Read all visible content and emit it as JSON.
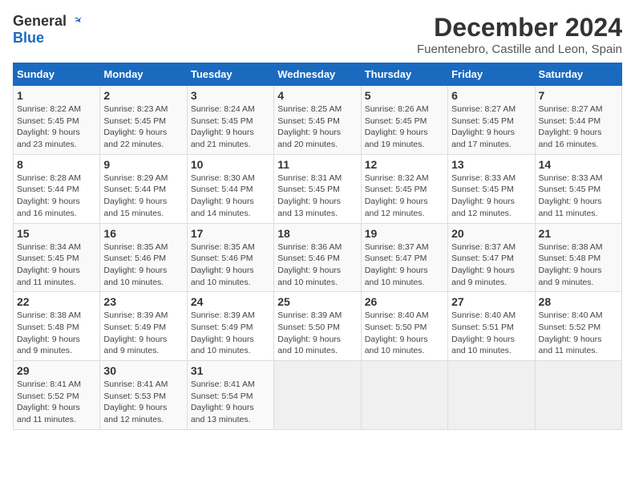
{
  "logo": {
    "general": "General",
    "blue": "Blue"
  },
  "title": "December 2024",
  "subtitle": "Fuentenebro, Castille and Leon, Spain",
  "days_of_week": [
    "Sunday",
    "Monday",
    "Tuesday",
    "Wednesday",
    "Thursday",
    "Friday",
    "Saturday"
  ],
  "weeks": [
    [
      {
        "day": "1",
        "info": "Sunrise: 8:22 AM\nSunset: 5:45 PM\nDaylight: 9 hours\nand 23 minutes."
      },
      {
        "day": "2",
        "info": "Sunrise: 8:23 AM\nSunset: 5:45 PM\nDaylight: 9 hours\nand 22 minutes."
      },
      {
        "day": "3",
        "info": "Sunrise: 8:24 AM\nSunset: 5:45 PM\nDaylight: 9 hours\nand 21 minutes."
      },
      {
        "day": "4",
        "info": "Sunrise: 8:25 AM\nSunset: 5:45 PM\nDaylight: 9 hours\nand 20 minutes."
      },
      {
        "day": "5",
        "info": "Sunrise: 8:26 AM\nSunset: 5:45 PM\nDaylight: 9 hours\nand 19 minutes."
      },
      {
        "day": "6",
        "info": "Sunrise: 8:27 AM\nSunset: 5:45 PM\nDaylight: 9 hours\nand 17 minutes."
      },
      {
        "day": "7",
        "info": "Sunrise: 8:27 AM\nSunset: 5:44 PM\nDaylight: 9 hours\nand 16 minutes."
      }
    ],
    [
      {
        "day": "8",
        "info": "Sunrise: 8:28 AM\nSunset: 5:44 PM\nDaylight: 9 hours\nand 16 minutes."
      },
      {
        "day": "9",
        "info": "Sunrise: 8:29 AM\nSunset: 5:44 PM\nDaylight: 9 hours\nand 15 minutes."
      },
      {
        "day": "10",
        "info": "Sunrise: 8:30 AM\nSunset: 5:44 PM\nDaylight: 9 hours\nand 14 minutes."
      },
      {
        "day": "11",
        "info": "Sunrise: 8:31 AM\nSunset: 5:45 PM\nDaylight: 9 hours\nand 13 minutes."
      },
      {
        "day": "12",
        "info": "Sunrise: 8:32 AM\nSunset: 5:45 PM\nDaylight: 9 hours\nand 12 minutes."
      },
      {
        "day": "13",
        "info": "Sunrise: 8:33 AM\nSunset: 5:45 PM\nDaylight: 9 hours\nand 12 minutes."
      },
      {
        "day": "14",
        "info": "Sunrise: 8:33 AM\nSunset: 5:45 PM\nDaylight: 9 hours\nand 11 minutes."
      }
    ],
    [
      {
        "day": "15",
        "info": "Sunrise: 8:34 AM\nSunset: 5:45 PM\nDaylight: 9 hours\nand 11 minutes."
      },
      {
        "day": "16",
        "info": "Sunrise: 8:35 AM\nSunset: 5:46 PM\nDaylight: 9 hours\nand 10 minutes."
      },
      {
        "day": "17",
        "info": "Sunrise: 8:35 AM\nSunset: 5:46 PM\nDaylight: 9 hours\nand 10 minutes."
      },
      {
        "day": "18",
        "info": "Sunrise: 8:36 AM\nSunset: 5:46 PM\nDaylight: 9 hours\nand 10 minutes."
      },
      {
        "day": "19",
        "info": "Sunrise: 8:37 AM\nSunset: 5:47 PM\nDaylight: 9 hours\nand 10 minutes."
      },
      {
        "day": "20",
        "info": "Sunrise: 8:37 AM\nSunset: 5:47 PM\nDaylight: 9 hours\nand 9 minutes."
      },
      {
        "day": "21",
        "info": "Sunrise: 8:38 AM\nSunset: 5:48 PM\nDaylight: 9 hours\nand 9 minutes."
      }
    ],
    [
      {
        "day": "22",
        "info": "Sunrise: 8:38 AM\nSunset: 5:48 PM\nDaylight: 9 hours\nand 9 minutes."
      },
      {
        "day": "23",
        "info": "Sunrise: 8:39 AM\nSunset: 5:49 PM\nDaylight: 9 hours\nand 9 minutes."
      },
      {
        "day": "24",
        "info": "Sunrise: 8:39 AM\nSunset: 5:49 PM\nDaylight: 9 hours\nand 10 minutes."
      },
      {
        "day": "25",
        "info": "Sunrise: 8:39 AM\nSunset: 5:50 PM\nDaylight: 9 hours\nand 10 minutes."
      },
      {
        "day": "26",
        "info": "Sunrise: 8:40 AM\nSunset: 5:50 PM\nDaylight: 9 hours\nand 10 minutes."
      },
      {
        "day": "27",
        "info": "Sunrise: 8:40 AM\nSunset: 5:51 PM\nDaylight: 9 hours\nand 10 minutes."
      },
      {
        "day": "28",
        "info": "Sunrise: 8:40 AM\nSunset: 5:52 PM\nDaylight: 9 hours\nand 11 minutes."
      }
    ],
    [
      {
        "day": "29",
        "info": "Sunrise: 8:41 AM\nSunset: 5:52 PM\nDaylight: 9 hours\nand 11 minutes."
      },
      {
        "day": "30",
        "info": "Sunrise: 8:41 AM\nSunset: 5:53 PM\nDaylight: 9 hours\nand 12 minutes."
      },
      {
        "day": "31",
        "info": "Sunrise: 8:41 AM\nSunset: 5:54 PM\nDaylight: 9 hours\nand 13 minutes."
      },
      null,
      null,
      null,
      null
    ]
  ]
}
